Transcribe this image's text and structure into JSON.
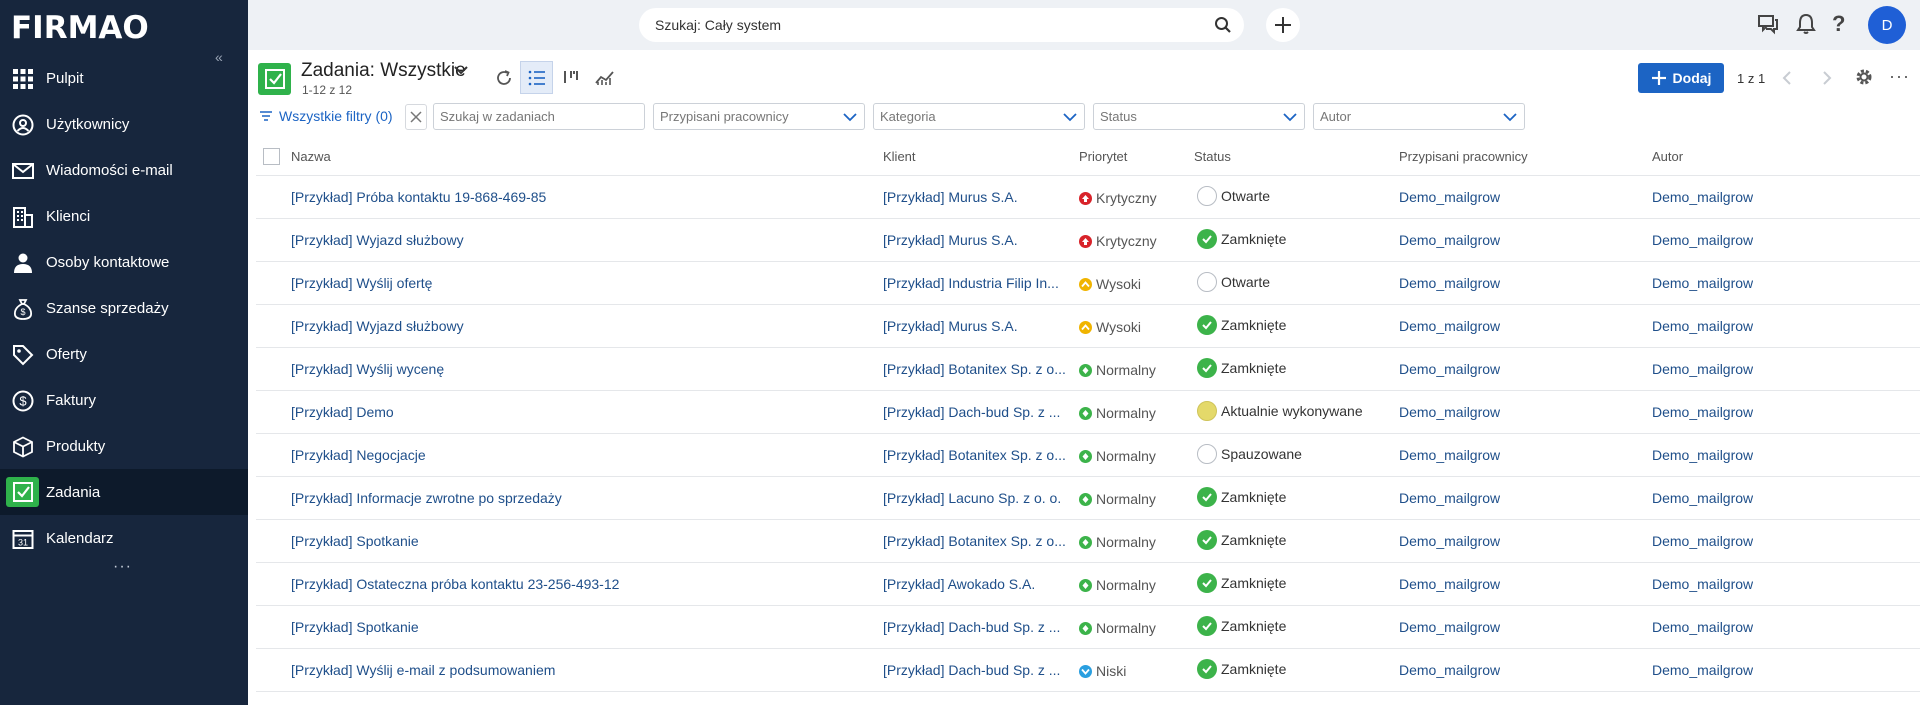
{
  "app": {
    "logo": "FIRMAO",
    "collapse": "«",
    "more": "···"
  },
  "sidebar": {
    "items": [
      {
        "label": "Pulpit",
        "icon": "grid-icon",
        "active": false
      },
      {
        "label": "Użytkownicy",
        "icon": "user-circle-icon",
        "active": false
      },
      {
        "label": "Wiadomości e-mail",
        "icon": "mail-icon",
        "active": false
      },
      {
        "label": "Klienci",
        "icon": "building-icon",
        "active": false
      },
      {
        "label": "Osoby kontaktowe",
        "icon": "person-icon",
        "active": false
      },
      {
        "label": "Szanse sprzedaży",
        "icon": "money-bag-icon",
        "active": false
      },
      {
        "label": "Oferty",
        "icon": "tag-icon",
        "active": false
      },
      {
        "label": "Faktury",
        "icon": "dollar-icon",
        "active": false
      },
      {
        "label": "Produkty",
        "icon": "box-icon",
        "active": false
      },
      {
        "label": "Zadania",
        "icon": "checkbox-icon",
        "active": true
      },
      {
        "label": "Kalendarz",
        "icon": "calendar-icon",
        "active": false
      }
    ]
  },
  "topbar": {
    "search_placeholder": "Szukaj: Cały system",
    "avatar": "D"
  },
  "header": {
    "title": "Zadania: Wszystkie",
    "count": "1-12 z 12",
    "add_label": "Dodaj",
    "pager": "1  z 1"
  },
  "filters": {
    "all_filters": "Wszystkie filtry (0)",
    "search_placeholder": "Szukaj w zadaniach",
    "assigned": "Przypisani pracownicy",
    "category": "Kategoria",
    "status": "Status",
    "author": "Autor"
  },
  "table": {
    "columns": [
      "Nazwa",
      "Klient",
      "Priorytet",
      "Status",
      "Przypisani pracownicy",
      "Autor"
    ],
    "rows": [
      {
        "name": "[Przykład] Próba kontaktu   19-868-469-85",
        "client": "[Przykład] Murus S.A.",
        "priority": "Krytyczny",
        "status": "Otwarte",
        "assigned": "Demo_mailgrow",
        "author": "Demo_mailgrow"
      },
      {
        "name": "[Przykład] Wyjazd służbowy",
        "client": "[Przykład] Murus S.A.",
        "priority": "Krytyczny",
        "status": "Zamknięte",
        "assigned": "Demo_mailgrow",
        "author": "Demo_mailgrow"
      },
      {
        "name": "[Przykład] Wyślij ofertę",
        "client": "[Przykład] Industria Filip In...",
        "priority": "Wysoki",
        "status": "Otwarte",
        "assigned": "Demo_mailgrow",
        "author": "Demo_mailgrow"
      },
      {
        "name": "[Przykład] Wyjazd służbowy",
        "client": "[Przykład] Murus S.A.",
        "priority": "Wysoki",
        "status": "Zamknięte",
        "assigned": "Demo_mailgrow",
        "author": "Demo_mailgrow"
      },
      {
        "name": "[Przykład] Wyślij wycenę",
        "client": "[Przykład] Botanitex Sp. z o...",
        "priority": "Normalny",
        "status": "Zamknięte",
        "assigned": "Demo_mailgrow",
        "author": "Demo_mailgrow"
      },
      {
        "name": "[Przykład] Demo",
        "client": "[Przykład] Dach-bud Sp. z ...",
        "priority": "Normalny",
        "status": "Aktualnie wykonywane",
        "assigned": "Demo_mailgrow",
        "author": "Demo_mailgrow"
      },
      {
        "name": "[Przykład] Negocjacje",
        "client": "[Przykład] Botanitex Sp. z o...",
        "priority": "Normalny",
        "status": "Spauzowane",
        "assigned": "Demo_mailgrow",
        "author": "Demo_mailgrow"
      },
      {
        "name": "[Przykład] Informacje zwrotne po sprzedaży",
        "client": "[Przykład] Lacuno Sp. z o. o.",
        "priority": "Normalny",
        "status": "Zamknięte",
        "assigned": "Demo_mailgrow",
        "author": "Demo_mailgrow"
      },
      {
        "name": "[Przykład] Spotkanie",
        "client": "[Przykład] Botanitex Sp. z o...",
        "priority": "Normalny",
        "status": "Zamknięte",
        "assigned": "Demo_mailgrow",
        "author": "Demo_mailgrow"
      },
      {
        "name": "[Przykład] Ostateczna próba kontaktu   23-256-493-12",
        "client": "[Przykład] Awokado S.A.",
        "priority": "Normalny",
        "status": "Zamknięte",
        "assigned": "Demo_mailgrow",
        "author": "Demo_mailgrow"
      },
      {
        "name": "[Przykład] Spotkanie",
        "client": "[Przykład] Dach-bud Sp. z ...",
        "priority": "Normalny",
        "status": "Zamknięte",
        "assigned": "Demo_mailgrow",
        "author": "Demo_mailgrow"
      },
      {
        "name": "[Przykład] Wyślij e-mail z podsumowaniem",
        "client": "[Przykład] Dach-bud Sp. z ...",
        "priority": "Niski",
        "status": "Zamknięte",
        "assigned": "Demo_mailgrow",
        "author": "Demo_mailgrow"
      }
    ]
  },
  "colors": {
    "sidebar_bg": "#17263d",
    "accent_green": "#2fb24b",
    "primary_blue": "#1c64c4",
    "link": "#1f4f8a",
    "priority_critical": "#d8232a",
    "priority_high": "#f0b400",
    "priority_normal": "#3cb34a",
    "priority_low": "#2a9fe0",
    "status_closed": "#3cb34a",
    "status_in_progress": "#e4d96a"
  }
}
